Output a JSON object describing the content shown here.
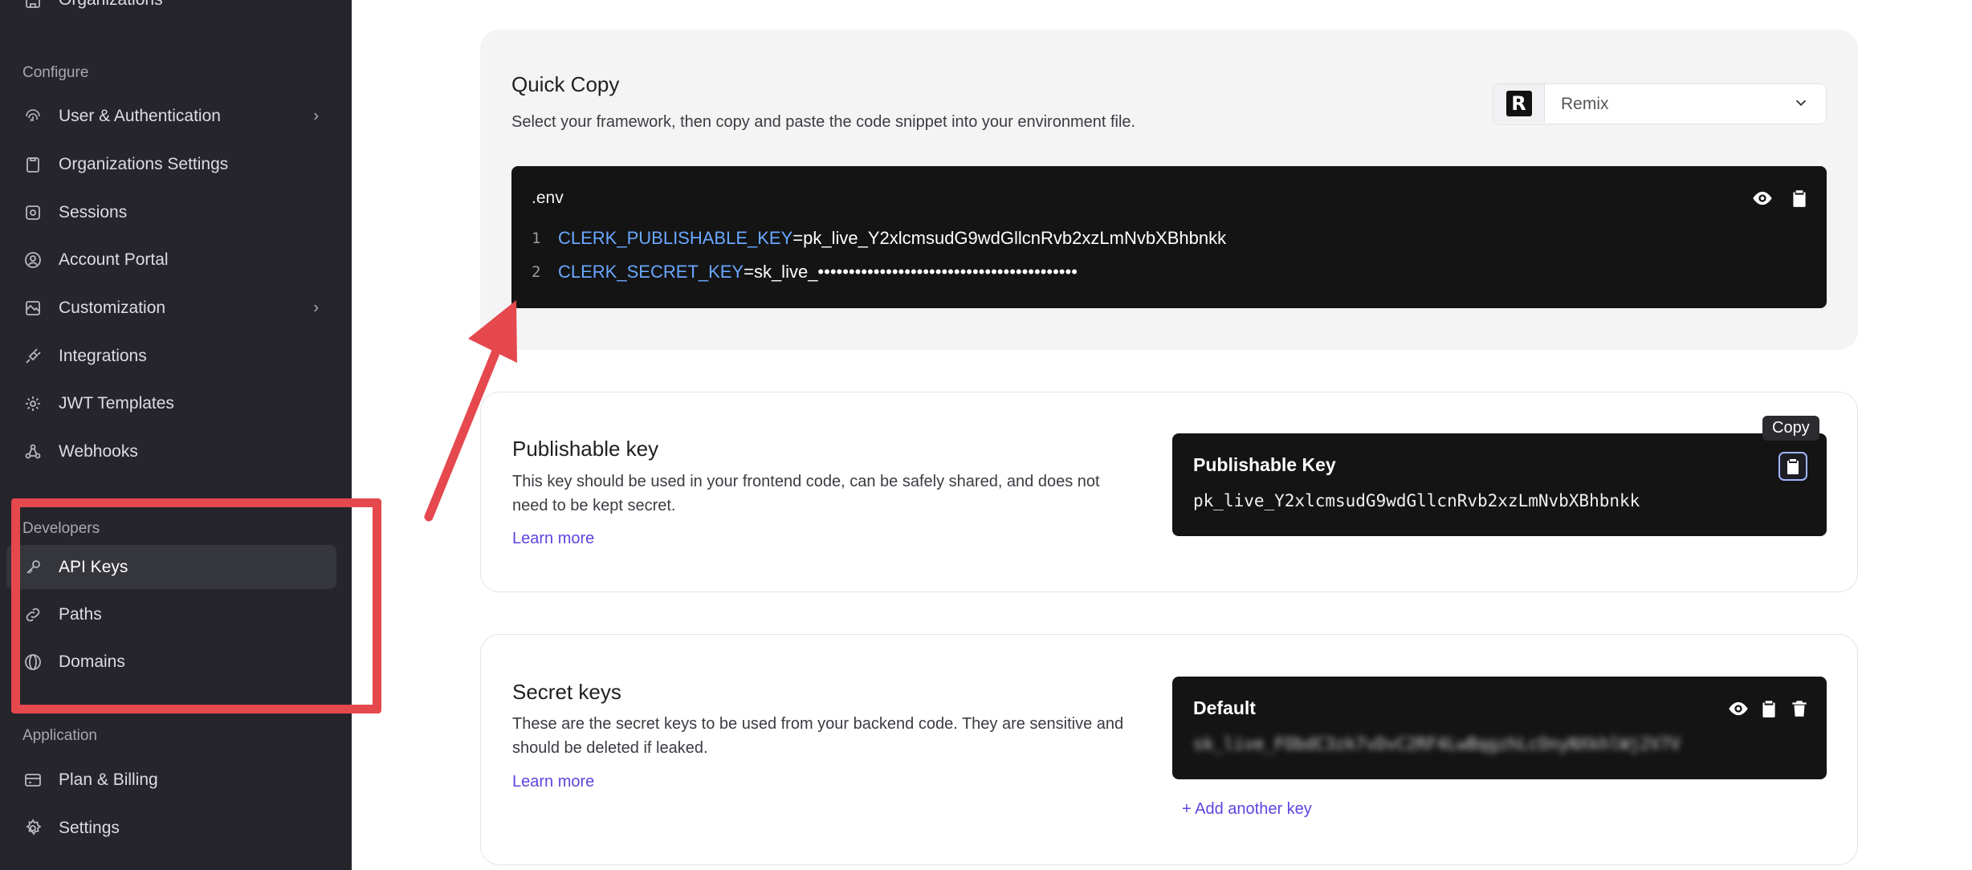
{
  "sidebar": {
    "top_item": "Organizations",
    "sections": {
      "configure": "Configure",
      "developers": "Developers",
      "application": "Application"
    },
    "items": [
      {
        "label": "User & Authentication",
        "icon": "fingerprint-icon",
        "chevron": true
      },
      {
        "label": "Organizations Settings",
        "icon": "clipboard-icon",
        "chevron": false
      },
      {
        "label": "Sessions",
        "icon": "sessions-icon",
        "chevron": false
      },
      {
        "label": "Account Portal",
        "icon": "user-circle-icon",
        "chevron": false
      },
      {
        "label": "Customization",
        "icon": "paint-icon",
        "chevron": true
      },
      {
        "label": "Integrations",
        "icon": "plug-icon",
        "chevron": false
      },
      {
        "label": "JWT Templates",
        "icon": "gear-icon",
        "chevron": false
      },
      {
        "label": "Webhooks",
        "icon": "webhook-icon",
        "chevron": false
      },
      {
        "label": "API Keys",
        "icon": "key-icon",
        "active": true
      },
      {
        "label": "Paths",
        "icon": "link-icon"
      },
      {
        "label": "Domains",
        "icon": "globe-icon"
      },
      {
        "label": "Plan & Billing",
        "icon": "credit-card-icon"
      },
      {
        "label": "Settings",
        "icon": "settings-icon"
      }
    ]
  },
  "quick_copy": {
    "title": "Quick Copy",
    "description": "Select your framework, then copy and paste the code snippet into your environment file.",
    "framework": {
      "selected": "Remix",
      "logo_letter": "R"
    },
    "file_name": ".env",
    "lines": [
      {
        "num": "1",
        "key": "CLERK_PUBLISHABLE_KEY",
        "value": "=pk_live_Y2xlcmsudG9wdGllcnRvb2xzLmNvbXBhbnkk"
      },
      {
        "num": "2",
        "key": "CLERK_SECRET_KEY",
        "value": "=sk_live_••••••••••••••••••••••••••••••••••••••••••"
      }
    ]
  },
  "publishable": {
    "title": "Publishable key",
    "description_1": "This key should be used in your frontend code, can be safely shared, and does not",
    "description_2": "need to be kept secret.",
    "learn_more": "Learn more",
    "box_title": "Publishable Key",
    "key_value": "pk_live_Y2xlcmsudG9wdGllcnRvb2xzLmNvbXBhbnkk",
    "tooltip": "Copy"
  },
  "secret": {
    "title": "Secret keys",
    "description_1": "These are the secret keys to be used from your backend code. They are sensitive and",
    "description_2": "should be deleted if leaked.",
    "learn_more": "Learn more",
    "box_title": "Default",
    "key_value_blurred": "sk_live_FObdC3zk7vDvC2RF4LwBqgzhLcOnyNXkhlWj2V7V",
    "add_key": "+ Add another key"
  },
  "colors": {
    "sidebar_bg": "#25252b",
    "accent": "#5b45e0",
    "code_key": "#6aa7ff",
    "annotation_red": "#e5484d"
  }
}
